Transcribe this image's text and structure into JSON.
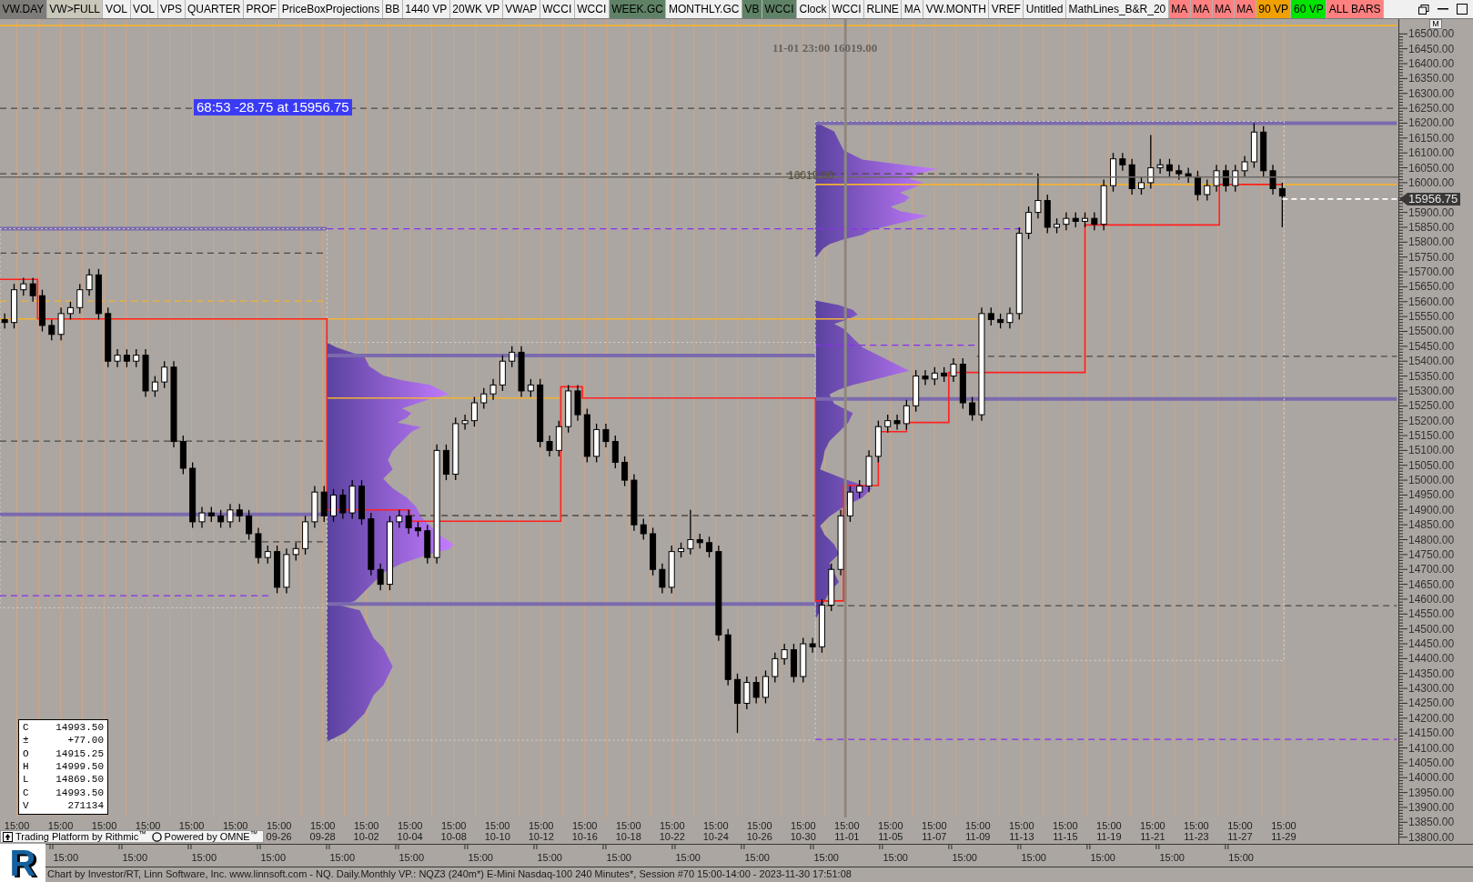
{
  "toolbar": {
    "buttons": [
      {
        "label": "VW.DAY",
        "color": "#7e7c79"
      },
      {
        "label": "VW>FULL",
        "color": "#c9c7b9"
      },
      {
        "label": "VOL",
        "color": "#f0f0f0"
      },
      {
        "label": "VOL",
        "color": "#f0f0f0"
      },
      {
        "label": "VPS",
        "color": "#f0f0f0"
      },
      {
        "label": "QUARTER",
        "color": "#f0f0f0"
      },
      {
        "label": "PROF",
        "color": "#f0f0f0"
      },
      {
        "label": "PriceBoxProjections",
        "color": "#f0f0f0"
      },
      {
        "label": "BB",
        "color": "#f0f0f0"
      },
      {
        "label": "1440 VP",
        "color": "#f0f0f0"
      },
      {
        "label": "20WK VP",
        "color": "#f0f0f0"
      },
      {
        "label": "VWAP",
        "color": "#f0f0f0"
      },
      {
        "label": "WCCI",
        "color": "#f0f0f0"
      },
      {
        "label": "WCCI",
        "color": "#f0f0f0"
      },
      {
        "label": "WEEK.GC",
        "color": "#5f8266"
      },
      {
        "label": "MONTHLY.GC",
        "color": "#f0f0f0"
      },
      {
        "label": "VB",
        "color": "#5f8266"
      },
      {
        "label": "WCCI",
        "color": "#5f8266"
      },
      {
        "label": "Clock",
        "color": "#f0f0f0"
      },
      {
        "label": "WCCI",
        "color": "#f0f0f0"
      },
      {
        "label": "RLINE",
        "color": "#f0f0f0"
      },
      {
        "label": "MA",
        "color": "#f0f0f0"
      },
      {
        "label": "VW.MONTH",
        "color": "#f0f0f0"
      },
      {
        "label": "VREF",
        "color": "#f0f0f0"
      },
      {
        "label": "Untitled",
        "color": "#f0f0f0"
      },
      {
        "label": "MathLines_B&R_20",
        "color": "#f0f0f0"
      },
      {
        "label": "MA",
        "color": "#ff8080"
      },
      {
        "label": "MA",
        "color": "#ff8080"
      },
      {
        "label": "MA",
        "color": "#ff8080"
      },
      {
        "label": "MA",
        "color": "#ff8080"
      },
      {
        "label": "90 VP",
        "color": "#f0a000"
      },
      {
        "label": "60 VP",
        "color": "#00e400"
      },
      {
        "label": "ALL BARS",
        "color": "#ff8080"
      }
    ]
  },
  "chart": {
    "cursor_readout": "11-01 23:00 16019.00",
    "measure_label": "68:53 -28.75 at 15956.75",
    "crosshair_price_label": "16019.00",
    "data_box": [
      {
        "label": "C",
        "value": "14993.50"
      },
      {
        "label": "±",
        "value": "+77.00"
      },
      {
        "label": "O",
        "value": "14915.25"
      },
      {
        "label": "H",
        "value": "14999.50"
      },
      {
        "label": "L",
        "value": "14869.50"
      },
      {
        "label": "C",
        "value": "14993.50"
      },
      {
        "label": "V",
        "value": "271134"
      }
    ],
    "time_axis": [
      {
        "time": "15:00"
      },
      {
        "time": "15:00"
      },
      {
        "time": "15:00"
      },
      {
        "time": "15:00"
      },
      {
        "time": "15:00"
      },
      {
        "time": "15:00"
      },
      {
        "time": "15:00",
        "date": "09-26"
      },
      {
        "time": "15:00",
        "date": "09-28"
      },
      {
        "time": "15:00",
        "date": "10-02"
      },
      {
        "time": "15:00",
        "date": "10-04"
      },
      {
        "time": "15:00",
        "date": "10-08"
      },
      {
        "time": "15:00",
        "date": "10-10"
      },
      {
        "time": "15:00",
        "date": "10-12"
      },
      {
        "time": "15:00",
        "date": "10-16"
      },
      {
        "time": "15:00",
        "date": "10-18"
      },
      {
        "time": "15:00",
        "date": "10-22"
      },
      {
        "time": "15:00",
        "date": "10-24"
      },
      {
        "time": "15:00",
        "date": "10-26"
      },
      {
        "time": "15:00",
        "date": "10-30"
      },
      {
        "time": "15:00",
        "date": "11-01"
      },
      {
        "time": "15:00",
        "date": "11-05"
      },
      {
        "time": "15:00",
        "date": "11-07"
      },
      {
        "time": "15:00",
        "date": "11-09"
      },
      {
        "time": "15:00",
        "date": "11-13"
      },
      {
        "time": "15:00",
        "date": "11-15"
      },
      {
        "time": "15:00",
        "date": "11-19"
      },
      {
        "time": "15:00",
        "date": "11-21"
      },
      {
        "time": "15:00",
        "date": "11-23"
      },
      {
        "time": "15:00",
        "date": "11-27"
      },
      {
        "time": "15:00",
        "date": "11-29"
      }
    ]
  },
  "price_axis": {
    "scale_button": "M",
    "last_price_tag": "15956.75",
    "labels": [
      "16500.00",
      "16450.00",
      "16400.00",
      "16350.00",
      "16300.00",
      "16250.00",
      "16200.00",
      "16150.00",
      "16100.00",
      "16050.00",
      "16000.00",
      "15900.00",
      "15850.00",
      "15800.00",
      "15750.00",
      "15700.00",
      "15650.00",
      "15600.00",
      "15550.00",
      "15500.00",
      "15450.00",
      "15400.00",
      "15350.00",
      "15300.00",
      "15250.00",
      "15200.00",
      "15150.00",
      "15100.00",
      "15050.00",
      "15000.00",
      "14950.00",
      "14900.00",
      "14850.00",
      "14800.00",
      "14750.00",
      "14700.00",
      "14650.00",
      "14600.00",
      "14550.00",
      "14500.00",
      "14450.00",
      "14400.00",
      "14350.00",
      "14300.00",
      "14250.00",
      "14200.00",
      "14150.00",
      "14100.00",
      "14050.00",
      "14000.00",
      "13950.00",
      "13900.00",
      "13850.00",
      "13800.00"
    ]
  },
  "footer": {
    "platform_credit": "Trading Platform by Rithmic$^{™}$",
    "engine_credit": "Powered by OMNE$^{™}$",
    "logo_letter": "R",
    "lower_time_axis": [
      "15:00",
      "15:00",
      "15:00",
      "15:00",
      "15:00",
      "15:00",
      "15:00",
      "15:00",
      "15:00",
      "15:00",
      "15:00",
      "15:00",
      "15:00",
      "15:00",
      "15:00",
      "15:00",
      "15:00",
      "15:00"
    ],
    "status": "Chart by Investor/RT, Linn Software, Inc. www.linnsoft.com - NQ. Daily.Monthly VP.: NQZ3 (240m*) E-Mini Nasdaq-100 240 Minutes*, Session #70 15:00-14:00 - 2023-11-30 17:51:08"
  }
}
